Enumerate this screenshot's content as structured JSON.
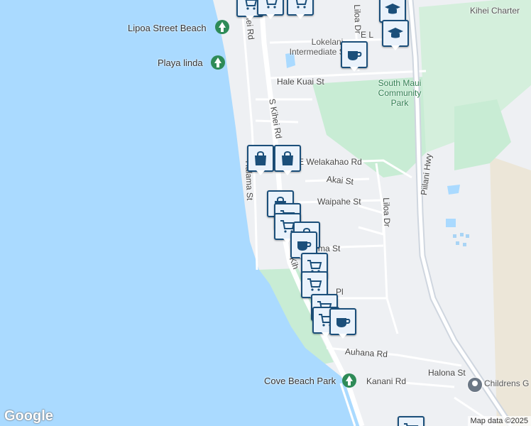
{
  "map": {
    "attribution": "Map data ©2025",
    "logo": "Google",
    "colors": {
      "water": "#aadaff",
      "land": "#eef0f3",
      "park": "#c8ecd4",
      "road": "#ffffff",
      "highway": "#cfd6df",
      "pin": "#1b4f7a"
    },
    "streets": {
      "s_kihei_rd_top": "ihei Rd",
      "s_kihei_rd": "S Kihei Rd",
      "liloa_dr_top": "Liloa Dr",
      "liloa_dr": "Liloa Dr",
      "e_l": "E L",
      "hale_kuai": "Hale Kuai St",
      "welakahao": "E Welakahao Rd",
      "akai": "Akai St",
      "waipahe": "Waipahe St",
      "halama": "Halama St",
      "piilani": "Piilani Hwy",
      "auhana": "Auhana Rd",
      "kanani": "Kanani Rd",
      "halona": "Halona St",
      "kihei_lower": "Kih",
      "ma_st": "ma St",
      "pl": "Pl"
    },
    "places": {
      "lipoa_beach": "Lipoa Street Beach",
      "playa_linda": "Playa linda",
      "intermediate_school": "Lokelani Intermediate School",
      "kihei_charter": "Kihei Charter",
      "south_maui_park": "South Maui Community Park",
      "cove_beach_park": "Cove Beach Park",
      "childrens": "Childrens G"
    },
    "markers": [
      {
        "icon": "shopping-cart-icon"
      },
      {
        "icon": "shopping-cart-icon"
      },
      {
        "icon": "shopping-cart-icon"
      },
      {
        "icon": "school-icon"
      },
      {
        "icon": "school-icon"
      },
      {
        "icon": "coffee-cup-icon"
      },
      {
        "icon": "shopping-bag-icon"
      },
      {
        "icon": "shopping-bag-icon"
      },
      {
        "icon": "shopping-bag-icon"
      },
      {
        "icon": "shopping-cart-icon"
      },
      {
        "icon": "shopping-cart-icon"
      },
      {
        "icon": "shopping-bag-icon"
      },
      {
        "icon": "coffee-cup-icon"
      },
      {
        "icon": "shopping-cart-icon"
      },
      {
        "icon": "shopping-cart-icon"
      },
      {
        "icon": "shopping-cart-icon"
      },
      {
        "icon": "shopping-cart-icon"
      },
      {
        "icon": "coffee-cup-icon"
      },
      {
        "icon": "shopping-cart-icon"
      }
    ]
  }
}
